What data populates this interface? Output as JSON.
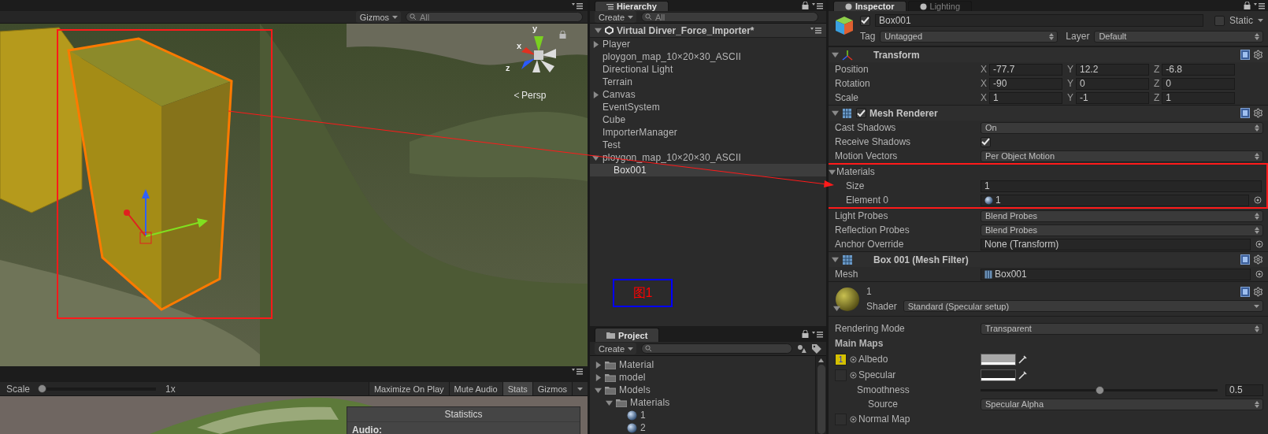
{
  "scene_view": {
    "gizmos_menu": "Gizmos",
    "search_placeholder": "All",
    "gizmo_labels": [
      "y",
      "x",
      "z"
    ],
    "projection": "Persp"
  },
  "game_view": {
    "scale_label": "Scale",
    "scale_slider": {
      "level": 0
    },
    "scale_value": "1x",
    "buttons": [
      {
        "label": "Maximize On Play",
        "selected": false
      },
      {
        "label": "Mute Audio",
        "selected": false
      },
      {
        "label": "Stats",
        "selected": true
      },
      {
        "label": "Gizmos",
        "selected": false
      }
    ],
    "statistics": {
      "title": "Statistics",
      "heading": "Audio:"
    }
  },
  "hierarchy": {
    "tab": "Hierarchy",
    "create_menu": "Create",
    "search_placeholder": "All",
    "scene_name": "Virtual Dirver_Force_Importer*",
    "scene_expanded": true,
    "items": [
      {
        "label": "Player",
        "expanded": false,
        "selected": false
      },
      {
        "label": "ploygon_map_10×20×30_ASCII",
        "selected": false
      },
      {
        "label": "Directional Light",
        "selected": false
      },
      {
        "label": "Terrain",
        "selected": false
      },
      {
        "label": "Canvas",
        "expanded": false,
        "selected": false
      },
      {
        "label": "EventSystem",
        "selected": false
      },
      {
        "label": "Cube",
        "selected": false
      },
      {
        "label": "ImporterManager",
        "selected": false
      },
      {
        "label": "Test",
        "selected": false
      },
      {
        "label": "ploygon_map_10×20×30_ASCII",
        "expanded": true,
        "selected": false,
        "children": [
          {
            "label": "Box001",
            "selected": true
          }
        ]
      }
    ]
  },
  "annotation": {
    "figure_label": "图1"
  },
  "project": {
    "tab": "Project",
    "create_menu": "Create",
    "items": [
      {
        "label": "Material",
        "kind": "folder",
        "expanded": false,
        "selected": false
      },
      {
        "label": "model",
        "kind": "folder",
        "expanded": false,
        "selected": false
      },
      {
        "label": "Models",
        "kind": "folder",
        "expanded": true,
        "selected": false,
        "children": [
          {
            "label": "Materials",
            "kind": "folder",
            "expanded": true,
            "selected": false,
            "children": [
              {
                "label": "1",
                "kind": "material",
                "selected": false
              },
              {
                "label": "2",
                "kind": "material",
                "selected": false
              }
            ]
          }
        ]
      }
    ]
  },
  "inspector": {
    "tabs": [
      {
        "label": "Inspector",
        "selected": true
      },
      {
        "label": "Lighting",
        "selected": false
      }
    ],
    "object": {
      "name": "Box001",
      "active": true,
      "static_label": "Static",
      "static": false,
      "tag_label": "Tag",
      "tag": "Untagged",
      "layer_label": "Layer",
      "layer": "Default"
    },
    "components": [
      {
        "kind": "transform",
        "title": "Transform",
        "expanded": true,
        "rows": [
          {
            "label": "Position",
            "values": [
              {
                "axis": "X",
                "value": "-77.7"
              },
              {
                "axis": "Y",
                "value": "12.2"
              },
              {
                "axis": "Z",
                "value": "-6.8"
              }
            ]
          },
          {
            "label": "Rotation",
            "values": [
              {
                "axis": "X",
                "value": "-90"
              },
              {
                "axis": "Y",
                "value": "0"
              },
              {
                "axis": "Z",
                "value": "0"
              }
            ]
          },
          {
            "label": "Scale",
            "values": [
              {
                "axis": "X",
                "value": "1"
              },
              {
                "axis": "Y",
                "value": "-1"
              },
              {
                "axis": "Z",
                "value": "1"
              }
            ]
          }
        ]
      },
      {
        "kind": "mesh_renderer",
        "title": "Mesh Renderer",
        "expanded": true,
        "enabled": true,
        "fields": [
          {
            "kind": "dropdown",
            "label": "Cast Shadows",
            "value": "On"
          },
          {
            "kind": "checkbox",
            "label": "Receive Shadows",
            "checked": true
          },
          {
            "kind": "dropdown",
            "label": "Motion Vectors",
            "value": "Per Object Motion"
          },
          {
            "kind": "foldout",
            "label": "Materials",
            "expanded": true,
            "highlighted": true,
            "children": [
              {
                "kind": "text",
                "label": "Size",
                "value": "1"
              },
              {
                "kind": "material_ref",
                "label": "Element 0",
                "value": "1"
              }
            ]
          },
          {
            "kind": "dropdown",
            "label": "Light Probes",
            "value": "Blend Probes"
          },
          {
            "kind": "dropdown",
            "label": "Reflection Probes",
            "value": "Blend Probes"
          },
          {
            "kind": "object",
            "label": "Anchor Override",
            "value": "None (Transform)"
          }
        ]
      },
      {
        "kind": "mesh_filter",
        "title": "Box 001 (Mesh Filter)",
        "expanded": true,
        "fields": [
          {
            "kind": "mesh_ref",
            "label": "Mesh",
            "value": "Box001"
          }
        ]
      },
      {
        "kind": "material",
        "title": "1",
        "expanded": true,
        "shader_label": "Shader",
        "shader": "Standard (Specular setup)",
        "fields": [
          {
            "kind": "dropdown",
            "label": "Rendering Mode",
            "value": "Transparent"
          },
          {
            "kind": "heading",
            "label": "Main Maps"
          },
          {
            "kind": "texture",
            "label": "Albedo",
            "thumb_text": "1",
            "color": "#a8a8a8"
          },
          {
            "kind": "texture",
            "label": "Specular",
            "color": "#262626",
            "children": [
              {
                "kind": "slider",
                "label": "Smoothness",
                "level": 0.5,
                "value": "0.5",
                "children": [
                  {
                    "kind": "dropdown",
                    "label": "Source",
                    "value": "Specular Alpha"
                  }
                ]
              }
            ]
          },
          {
            "kind": "texture",
            "label": "Normal Map"
          }
        ]
      }
    ]
  }
}
